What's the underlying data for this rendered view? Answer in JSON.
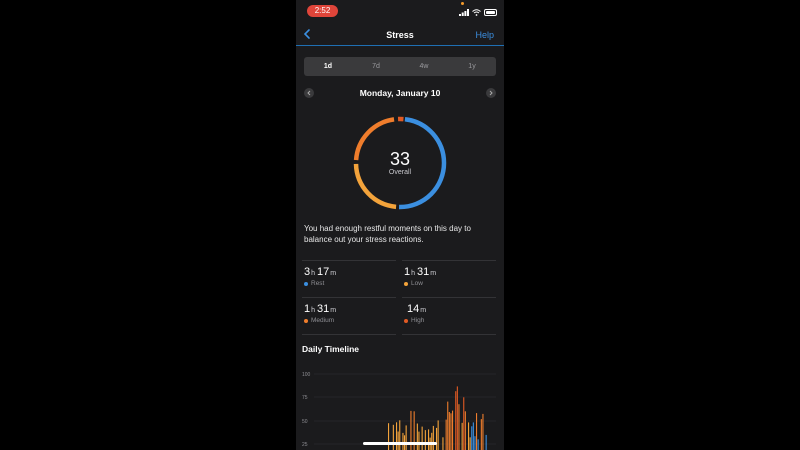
{
  "status_bar": {
    "time": "2:52"
  },
  "nav": {
    "title": "Stress",
    "help": "Help"
  },
  "tabs": [
    {
      "label": "1d",
      "active": true
    },
    {
      "label": "7d",
      "active": false
    },
    {
      "label": "4w",
      "active": false
    },
    {
      "label": "1y",
      "active": false
    }
  ],
  "date": "Monday, January 10",
  "summary": {
    "score": "33",
    "label": "Overall"
  },
  "message": "You had enough restful moments on this day to balance out your stress reactions.",
  "stats": [
    {
      "h": "3",
      "h_unit": "h",
      "m": "17",
      "m_unit": "m",
      "label": "Rest",
      "color": "#3b8fe0"
    },
    {
      "h": "1",
      "h_unit": "h",
      "m": "31",
      "m_unit": "m",
      "label": "Low",
      "color": "#f3a33b"
    },
    {
      "h": "1",
      "h_unit": "h",
      "m": "31",
      "m_unit": "m",
      "label": "Medium",
      "color": "#ef7d2c"
    },
    {
      "h": "",
      "h_unit": "",
      "m": "14",
      "m_unit": "m",
      "label": "High",
      "color": "#e15a24"
    }
  ],
  "timeline": {
    "title": "Daily Timeline",
    "y_ticks": [
      "100",
      "75",
      "50",
      "25"
    ]
  },
  "colors": {
    "rest": "#3b8fe0",
    "low": "#f3a33b",
    "medium": "#ef7d2c",
    "high": "#e15a24",
    "accent": "#3b8fe0"
  }
}
